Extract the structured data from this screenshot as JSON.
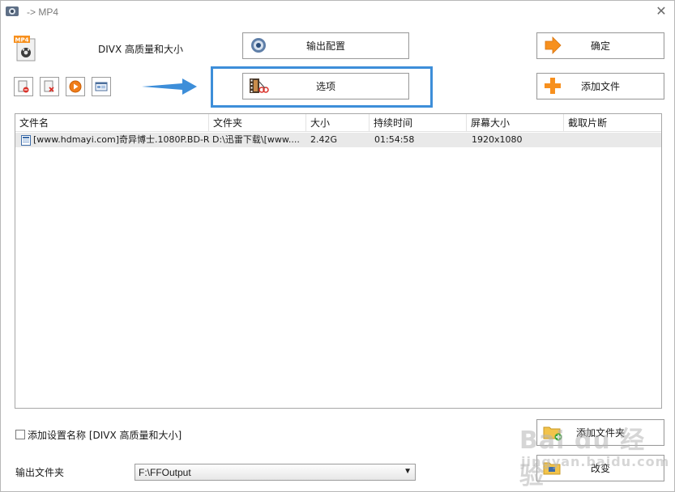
{
  "window": {
    "title": "-> MP4",
    "close_glyph": "✕"
  },
  "preset": {
    "name": "DIVX 高质量和大小",
    "icon": "mp4-file-icon",
    "icon_text": "MP4"
  },
  "buttons": {
    "output_config": "输出配置",
    "options": "选项",
    "ok": "确定",
    "add_file": "添加文件",
    "add_folder": "添加文件夹",
    "change": "改变"
  },
  "toolbar": [
    {
      "name": "remove-file",
      "icon": "file-remove-icon"
    },
    {
      "name": "clear-list",
      "icon": "file-clear-icon"
    },
    {
      "name": "play",
      "icon": "play-icon"
    },
    {
      "name": "media-info",
      "icon": "media-info-icon"
    }
  ],
  "table": {
    "columns": [
      "文件名",
      "文件夹",
      "大小",
      "持续时间",
      "屏幕大小",
      "截取片断"
    ],
    "rows": [
      {
        "filename": "[www.hdmayi.com]奇异博士.1080P.BD-R...",
        "folder": "D:\\迅雷下载\\[www....",
        "size": "2.42G",
        "duration": "01:54:58",
        "resolution": "1920x1080",
        "clip": ""
      }
    ]
  },
  "add_preset_name": {
    "label": "添加设置名称 [DIVX 高质量和大小]",
    "checked": false
  },
  "output_folder": {
    "label": "输出文件夹",
    "value": "F:\\FFOutput"
  },
  "watermark": {
    "main": "Bai du 经验",
    "sub": "jingyan.baidu.com"
  },
  "colors": {
    "highlight": "#3d8ed9",
    "row_bg": "#e9e9e9",
    "orange": "#f7901e"
  }
}
